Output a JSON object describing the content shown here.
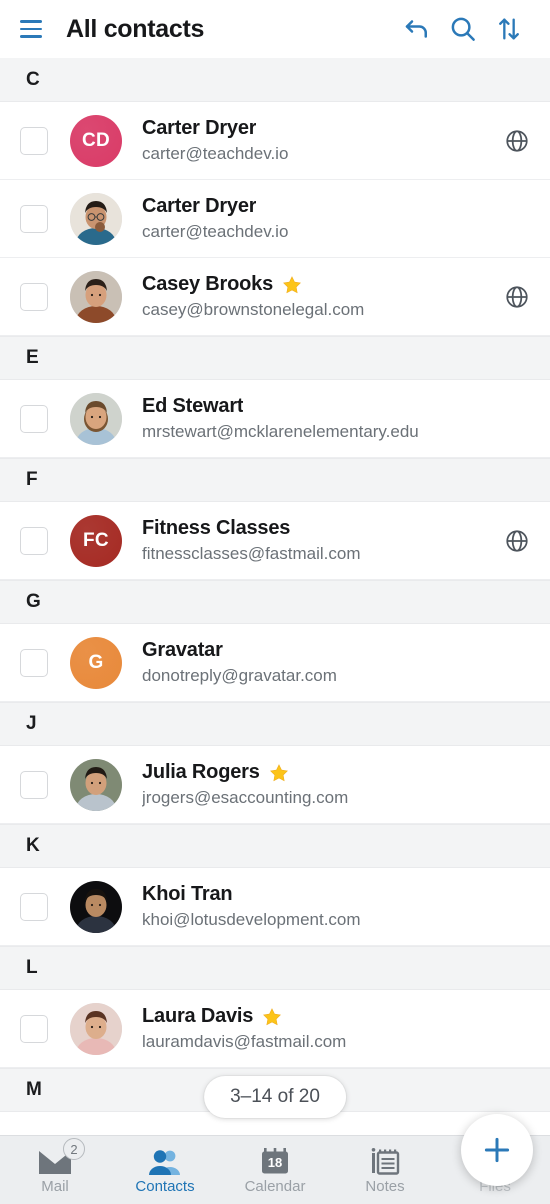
{
  "header": {
    "title": "All contacts",
    "menu_icon": "hamburger-icon",
    "undo_icon": "undo-icon",
    "search_icon": "search-icon",
    "sort_icon": "sort-icon",
    "accent_color": "#2b79b8"
  },
  "list": {
    "sections": [
      {
        "letter": "C",
        "contacts": [
          {
            "name": "Carter Dryer",
            "email": "carter@teachdev.io",
            "starred": false,
            "has_globe": true,
            "avatar": {
              "kind": "initials",
              "initials": "CD",
              "color": "#d93b67"
            }
          },
          {
            "name": "Carter Dryer",
            "email": "carter@teachdev.io",
            "starred": false,
            "has_globe": false,
            "avatar": {
              "kind": "photo",
              "photo": "man-drinking-coffee"
            }
          },
          {
            "name": "Casey Brooks",
            "email": "casey@brownstonelegal.com",
            "starred": true,
            "has_globe": true,
            "avatar": {
              "kind": "photo",
              "photo": "smiling-woman-dark-hair"
            }
          }
        ]
      },
      {
        "letter": "E",
        "contacts": [
          {
            "name": "Ed Stewart",
            "email": "mrstewart@mcklarenelementary.edu",
            "starred": false,
            "has_globe": false,
            "avatar": {
              "kind": "photo",
              "photo": "bearded-man-blue-shirt"
            }
          }
        ]
      },
      {
        "letter": "F",
        "contacts": [
          {
            "name": "Fitness Classes",
            "email": "fitnessclasses@fastmail.com",
            "starred": false,
            "has_globe": true,
            "avatar": {
              "kind": "initials",
              "initials": "FC",
              "color": "#a52a23"
            }
          }
        ]
      },
      {
        "letter": "G",
        "contacts": [
          {
            "name": "Gravatar",
            "email": "donotreply@gravatar.com",
            "starred": false,
            "has_globe": false,
            "avatar": {
              "kind": "initials",
              "initials": "G",
              "color": "#e8893a"
            }
          }
        ]
      },
      {
        "letter": "J",
        "contacts": [
          {
            "name": "Julia Rogers",
            "email": "jrogers@esaccounting.com",
            "starred": true,
            "has_globe": false,
            "avatar": {
              "kind": "photo",
              "photo": "woman-hand-on-chin"
            }
          }
        ]
      },
      {
        "letter": "K",
        "contacts": [
          {
            "name": "Khoi Tran",
            "email": "khoi@lotusdevelopment.com",
            "starred": false,
            "has_globe": false,
            "avatar": {
              "kind": "photo",
              "photo": "man-dark-background"
            }
          }
        ]
      },
      {
        "letter": "L",
        "contacts": [
          {
            "name": "Laura Davis",
            "email": "lauramdavis@fastmail.com",
            "starred": true,
            "has_globe": false,
            "avatar": {
              "kind": "photo",
              "photo": "woman-brown-hair"
            }
          }
        ]
      },
      {
        "letter": "M",
        "contacts": []
      }
    ]
  },
  "count_pill": {
    "text": "3–14 of 20"
  },
  "bottom_nav": {
    "items": [
      {
        "label": "Mail",
        "icon": "mail-icon",
        "active": false,
        "badge": "2",
        "dim": false
      },
      {
        "label": "Contacts",
        "icon": "contacts-icon",
        "active": true,
        "badge": null,
        "dim": false
      },
      {
        "label": "Calendar",
        "icon": "calendar-icon",
        "active": false,
        "badge": null,
        "day": "18",
        "dim": false
      },
      {
        "label": "Notes",
        "icon": "notes-icon",
        "active": false,
        "badge": null,
        "dim": false
      },
      {
        "label": "Files",
        "icon": "files-cloud-icon",
        "active": false,
        "badge": null,
        "dim": true
      }
    ]
  },
  "fab": {
    "label": "+",
    "icon": "plus-icon",
    "color": "#2b79b8"
  }
}
